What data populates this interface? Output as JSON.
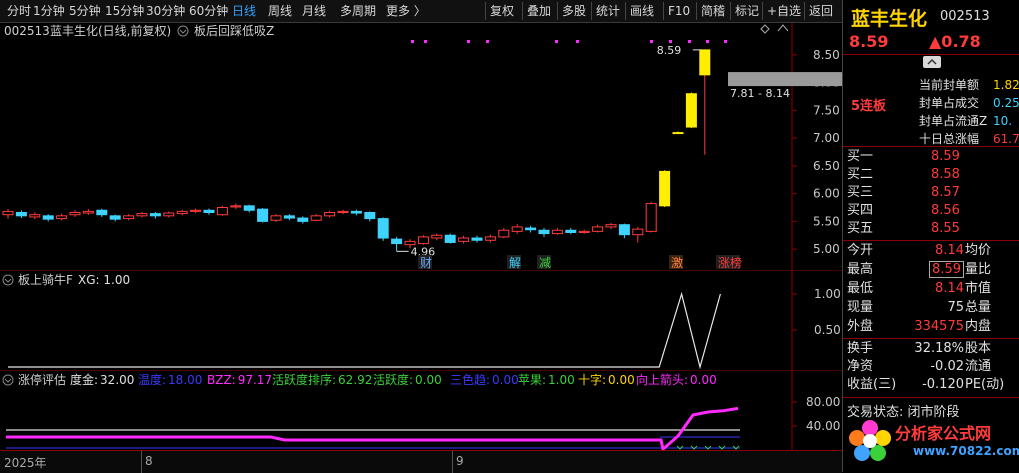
{
  "toolbar": {
    "left_items": [
      {
        "label": "分时",
        "active": false
      },
      {
        "label": "1分钟",
        "active": false
      },
      {
        "label": "5分钟",
        "active": false
      },
      {
        "label": "15分钟",
        "active": false
      },
      {
        "label": "30分钟",
        "active": false
      },
      {
        "label": "60分钟",
        "active": false
      },
      {
        "label": "日线",
        "active": true
      },
      {
        "label": "周线",
        "active": false
      },
      {
        "label": "月线",
        "active": false
      },
      {
        "label": "多周期",
        "active": false
      },
      {
        "label": "更多 〉",
        "active": false
      }
    ],
    "right_items": [
      "复权",
      "叠加",
      "多股",
      "统计",
      "画线",
      "F10",
      "简稽",
      "标记",
      "+自选",
      "返回"
    ]
  },
  "main_chart": {
    "header_code": "002513",
    "header_name": "蓝丰生化(日线,前复权)",
    "indicator_name": "板后回踩低吸Z",
    "price_labels": [
      "8.50",
      "8.00",
      "7.50",
      "7.00",
      "6.50",
      "6.00",
      "5.50",
      "5.00"
    ],
    "high_label": "8.59",
    "low_label": "4.96",
    "crosshair_label": "7.81 - 8.14",
    "event_tags": [
      {
        "text": "财",
        "color": "#6fa8ff"
      },
      {
        "text": "解",
        "color": "#3fd3ff"
      },
      {
        "text": "减",
        "color": "#3ad13a"
      },
      {
        "text": "激",
        "color": "#ff8040"
      },
      {
        "text": "涨榜",
        "color": "#ff3b3b"
      }
    ]
  },
  "pane2": {
    "title": "板上骑牛F",
    "value_text": "XG: 1.00",
    "axis_labels": [
      "1.00",
      "0.50"
    ]
  },
  "pane3": {
    "title": "涨停评估",
    "fields": [
      {
        "label": "度金:",
        "value": "32.00",
        "color": "#e0e0e0"
      },
      {
        "label": "温度:",
        "value": "18.00",
        "color": "#3a3aff"
      },
      {
        "label": "BZZ:",
        "value": "97.17",
        "color": "#ff2aff"
      },
      {
        "label": "活跃度排序:",
        "value": "62.92",
        "color": "#3ad13a"
      },
      {
        "label": "活跃度:",
        "value": "0.00",
        "color": "#3ad13a"
      },
      {
        "label": "三色趋:",
        "value": "0.00",
        "color": "#3a3aff"
      },
      {
        "label": "苹果:",
        "value": "1.00",
        "color": "#3ad13a"
      },
      {
        "label": "十字:",
        "value": "0.00",
        "color": "#ffd400"
      },
      {
        "label": "向上箭头:",
        "value": "0.00",
        "color": "#ff2aff"
      }
    ],
    "axis_labels": [
      "80.00",
      "40.00"
    ]
  },
  "timeline": {
    "year": "2025年",
    "month_a": "8",
    "month_b": "9"
  },
  "quote": {
    "name": "蓝丰生化",
    "code": "002513",
    "price": "8.59",
    "change": "▲0.78",
    "board_count": "5连板",
    "seal_rows": [
      {
        "label": "当前封单额",
        "value": "1.82"
      },
      {
        "label": "封单占成交",
        "value": "0.25"
      },
      {
        "label": "封单占流通Z",
        "value": "10."
      },
      {
        "label": "十日总涨幅",
        "value": "61.7"
      }
    ],
    "order_book": [
      {
        "label": "买一",
        "price": "8.59"
      },
      {
        "label": "买二",
        "price": "8.58"
      },
      {
        "label": "买三",
        "price": "8.57"
      },
      {
        "label": "买四",
        "price": "8.56"
      },
      {
        "label": "买五",
        "price": "8.55"
      }
    ],
    "stats": [
      {
        "l": "今开",
        "v": "8.14",
        "r": "均价",
        "vc": "#ff3b3b"
      },
      {
        "l": "最高",
        "v": "8.59",
        "r": "量比",
        "vc": "#ff3b3b",
        "boxed": true
      },
      {
        "l": "最低",
        "v": "8.14",
        "r": "市值",
        "vc": "#ff3b3b"
      },
      {
        "l": "现量",
        "v": "75",
        "r": "总量",
        "vc": "#e0e0e0"
      },
      {
        "l": "外盘",
        "v": "334575",
        "r": "内盘",
        "vc": "#ff3b3b"
      }
    ],
    "stats2": [
      {
        "l": "换手",
        "v": "32.18%",
        "r": "股本"
      },
      {
        "l": "净资",
        "v": "-0.02",
        "r": "流通"
      },
      {
        "l": "收益(三)",
        "v": "-0.120",
        "r": "PE(动)"
      }
    ],
    "status": "交易状态: 闭市阶段",
    "watermark_text": "分析家公式网",
    "watermark_url": "www.70822.com"
  },
  "chart_data": {
    "type": "candlestick",
    "candles": [
      [
        5.62,
        5.68,
        5.72,
        5.55
      ],
      [
        5.66,
        5.6,
        5.7,
        5.56
      ],
      [
        5.58,
        5.62,
        5.66,
        5.54
      ],
      [
        5.6,
        5.54,
        5.63,
        5.5
      ],
      [
        5.55,
        5.6,
        5.64,
        5.52
      ],
      [
        5.62,
        5.66,
        5.7,
        5.58
      ],
      [
        5.65,
        5.68,
        5.72,
        5.62
      ],
      [
        5.7,
        5.62,
        5.73,
        5.58
      ],
      [
        5.6,
        5.54,
        5.62,
        5.5
      ],
      [
        5.55,
        5.6,
        5.63,
        5.52
      ],
      [
        5.6,
        5.64,
        5.67,
        5.57
      ],
      [
        5.64,
        5.6,
        5.67,
        5.55
      ],
      [
        5.6,
        5.65,
        5.68,
        5.57
      ],
      [
        5.64,
        5.68,
        5.71,
        5.61
      ],
      [
        5.68,
        5.7,
        5.73,
        5.65
      ],
      [
        5.7,
        5.66,
        5.73,
        5.62
      ],
      [
        5.62,
        5.75,
        5.78,
        5.6
      ],
      [
        5.76,
        5.78,
        5.82,
        5.72
      ],
      [
        5.78,
        5.7,
        5.8,
        5.66
      ],
      [
        5.72,
        5.5,
        5.74,
        5.48
      ],
      [
        5.52,
        5.6,
        5.63,
        5.49
      ],
      [
        5.6,
        5.56,
        5.63,
        5.52
      ],
      [
        5.56,
        5.5,
        5.59,
        5.46
      ],
      [
        5.52,
        5.6,
        5.63,
        5.5
      ],
      [
        5.6,
        5.66,
        5.69,
        5.57
      ],
      [
        5.66,
        5.68,
        5.71,
        5.63
      ],
      [
        5.68,
        5.65,
        5.71,
        5.61
      ],
      [
        5.66,
        5.55,
        5.68,
        5.5
      ],
      [
        5.55,
        5.2,
        5.57,
        5.15
      ],
      [
        5.18,
        5.1,
        5.22,
        4.96
      ],
      [
        5.08,
        5.14,
        5.18,
        5.02
      ],
      [
        5.1,
        5.22,
        5.25,
        5.08
      ],
      [
        5.2,
        5.25,
        5.28,
        5.16
      ],
      [
        5.25,
        5.12,
        5.28,
        5.1
      ],
      [
        5.14,
        5.2,
        5.24,
        5.1
      ],
      [
        5.2,
        5.16,
        5.24,
        5.12
      ],
      [
        5.16,
        5.22,
        5.26,
        5.12
      ],
      [
        5.22,
        5.34,
        5.38,
        5.2
      ],
      [
        5.32,
        5.4,
        5.45,
        5.28
      ],
      [
        5.38,
        5.35,
        5.42,
        5.3
      ],
      [
        5.34,
        5.28,
        5.38,
        5.22
      ],
      [
        5.28,
        5.34,
        5.38,
        5.26
      ],
      [
        5.34,
        5.3,
        5.38,
        5.27
      ],
      [
        5.3,
        5.32,
        5.35,
        5.28
      ],
      [
        5.32,
        5.4,
        5.44,
        5.3
      ],
      [
        5.4,
        5.44,
        5.47,
        5.36
      ],
      [
        5.44,
        5.26,
        5.46,
        5.2
      ],
      [
        5.26,
        5.36,
        5.4,
        5.12
      ],
      [
        5.32,
        5.82,
        5.85,
        5.3
      ],
      [
        5.78,
        6.4,
        6.42,
        5.76
      ],
      [
        7.1,
        7.1,
        7.12,
        7.08
      ],
      [
        7.2,
        7.8,
        7.82,
        7.18
      ],
      [
        8.14,
        8.59,
        8.59,
        6.7
      ]
    ],
    "ylim": [
      4.75,
      8.75
    ],
    "pane2_xg": [
      0,
      0,
      0,
      0,
      0,
      0,
      0,
      0,
      0,
      0,
      0,
      0,
      0,
      0,
      0,
      0,
      0,
      0,
      0,
      0,
      0,
      0,
      0,
      0,
      0,
      0,
      0,
      0,
      0,
      0,
      0,
      0,
      0,
      0,
      0,
      0,
      0,
      0,
      0,
      0,
      0,
      0,
      0,
      0,
      0,
      0,
      0,
      0,
      0,
      1,
      0,
      1
    ],
    "pane3_magenta": [
      18,
      18,
      18,
      18,
      18,
      18,
      18,
      18,
      18,
      18,
      18,
      18,
      18,
      18,
      18,
      18,
      18,
      18,
      18,
      18,
      18,
      18,
      18,
      18,
      18,
      18,
      18,
      18,
      18,
      18,
      18,
      18,
      18,
      18,
      18,
      18,
      18,
      18,
      18,
      18,
      18,
      18,
      18,
      18,
      18,
      18,
      18,
      18,
      18,
      40,
      75,
      80,
      82,
      86
    ],
    "pane3_ylim": [
      0,
      100
    ]
  }
}
